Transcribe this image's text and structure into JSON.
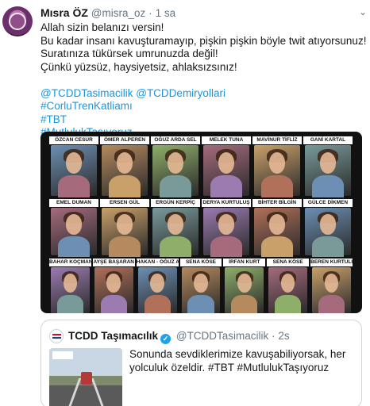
{
  "tweet": {
    "display_name": "Mısra ÖZ",
    "handle": "@misra_oz",
    "separator": "·",
    "time": "1 sa",
    "lines": [
      "Allah sizin belanızı versin!",
      "Bu kadar insanı kavuşturamayıp, pişkin pişkin böyle twit atıyorsunuz!",
      "Suratınıza tükürsek umrunuzda değil!",
      "Çünkü yüzsüz, haysiyetsiz, ahlaksızsınız!"
    ],
    "mentions": [
      "@TCDDTasimacilik",
      "@TCDDemiryollari"
    ],
    "hashtags": [
      "#CorluTrenKatliamı",
      "#TBT",
      "#MutlulukTaşıyoruz"
    ]
  },
  "media": {
    "rows": [
      [
        "ÖZCAN CESUR",
        "ÖMER ALPEREN",
        "OĞUZ ARDA SEL",
        "MELEK TUNA",
        "MAVİNUR TİFLİZ",
        "GANİ KARTAL"
      ],
      [
        "EMEL DUMAN",
        "ERSEN GÜL",
        "ERGÜN KERPİÇ",
        "DERYA KURTULUŞ",
        "BİHTER BİLGİN",
        "GÜLCE DİKMEN"
      ],
      [
        "BAHAR KOÇMAN",
        "AYŞE BAŞARAN",
        "HAKAN - OĞUZ ARDA SEL",
        "SENA KÖSE",
        "İRFAN KURT",
        "SENA KÖSE",
        "BEREN KURTULUŞ"
      ]
    ]
  },
  "quoted": {
    "display_name": "TCDD Taşımacılık",
    "verified_mark": "✓",
    "handle": "@TCDDTasimacilik",
    "separator": "·",
    "time": "2s",
    "text": "Sonunda sevdiklerimize kavuşabiliyorsak, her yolculuk özeldir. #TBT #MutlulukTaşıyoruz"
  },
  "icons": {
    "caret": "chevron-down-icon"
  },
  "colors": {
    "link": "#1b95e0",
    "verified": "#1da1f2",
    "secondary_text": "#657786"
  }
}
